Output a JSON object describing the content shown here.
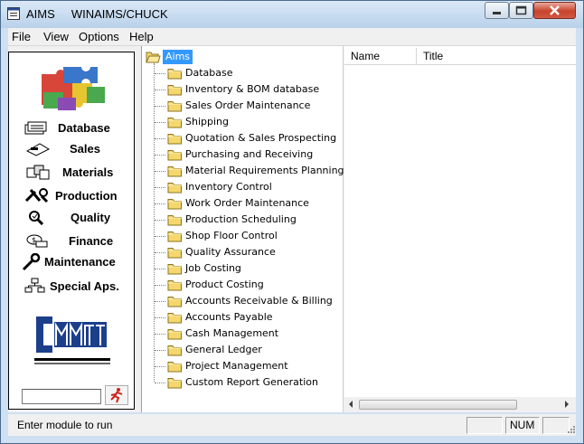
{
  "window": {
    "title": "AIMS     WINAIMS/CHUCK"
  },
  "menu": {
    "items": [
      "File",
      "View",
      "Options",
      "Help"
    ]
  },
  "modules": {
    "items": [
      {
        "label": "Database",
        "icon": "database-icon"
      },
      {
        "label": "Sales",
        "icon": "sales-icon"
      },
      {
        "label": "Materials",
        "icon": "materials-icon"
      },
      {
        "label": "Production",
        "icon": "production-icon"
      },
      {
        "label": "Quality",
        "icon": "quality-icon"
      },
      {
        "label": "Finance",
        "icon": "finance-icon"
      },
      {
        "label": "Maintenance",
        "icon": "maintenance-icon"
      },
      {
        "label": "Special Aps.",
        "icon": "special-apps-icon"
      }
    ],
    "input_value": ""
  },
  "tree": {
    "root": "Aims",
    "items": [
      "Database",
      "Inventory & BOM database",
      "Sales Order Maintenance",
      "Shipping",
      "Quotation & Sales Prospecting",
      "Purchasing and Receiving",
      "Material Requirements Planning",
      "Inventory Control",
      "Work Order Maintenance",
      "Production Scheduling",
      "Shop Floor Control",
      "Quality Assurance",
      "Job Costing",
      "Product Costing",
      "Accounts Receivable & Billing",
      "Accounts Payable",
      "Cash Management",
      "General Ledger",
      "Project Management",
      "Custom Report Generation"
    ]
  },
  "list": {
    "columns": [
      "Name",
      "Title"
    ]
  },
  "status": {
    "message": "Enter module to run",
    "num": "NUM"
  },
  "colors": {
    "selection": "#3399ff",
    "folder": "#f5d76e"
  }
}
